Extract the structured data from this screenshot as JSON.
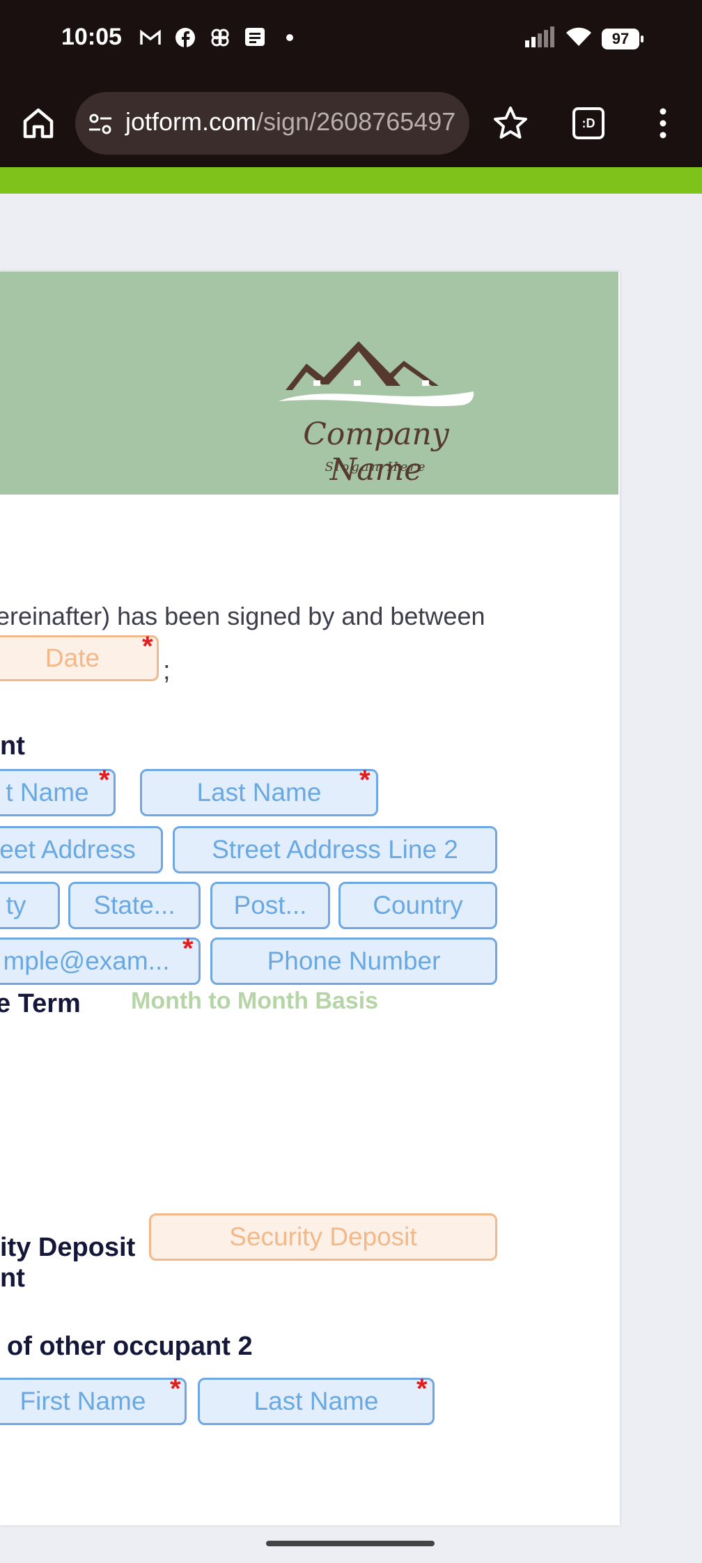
{
  "status": {
    "time": "10:05",
    "battery": "97"
  },
  "browser": {
    "url_domain": "jotform.com",
    "url_path": "/sign/2608765497",
    "tabs_label": ":D"
  },
  "brand": {
    "company_name": "Company Name",
    "slogan": "Slogan Here"
  },
  "form": {
    "intro_text": "ereinafter) has been signed by and between",
    "date_placeholder": "Date",
    "semicolon": ";",
    "tenant_label": "nt",
    "first_name": "t Name",
    "last_name": "Last Name",
    "street": "eet Address",
    "street2": "Street Address Line 2",
    "city": "ty",
    "state": "State...",
    "postal": "Post...",
    "country": "Country",
    "email": "mple@exam...",
    "phone": "Phone Number",
    "lease_term_label": "e Term",
    "lease_term_value": "Month to Month Basis",
    "security_label_1": "ity Deposit",
    "security_label_2": "nt",
    "security_placeholder": "Security Deposit",
    "occupant_label": "of other occupant 2",
    "occ_first": "First Name",
    "occ_last": "Last Name",
    "required_mark": "*"
  },
  "colors": {
    "accent_green": "#80c21c",
    "header_green": "#a6c5a4",
    "field_blue": "#6fa7e3",
    "field_orange": "#f2b889",
    "required_red": "#e02020"
  }
}
